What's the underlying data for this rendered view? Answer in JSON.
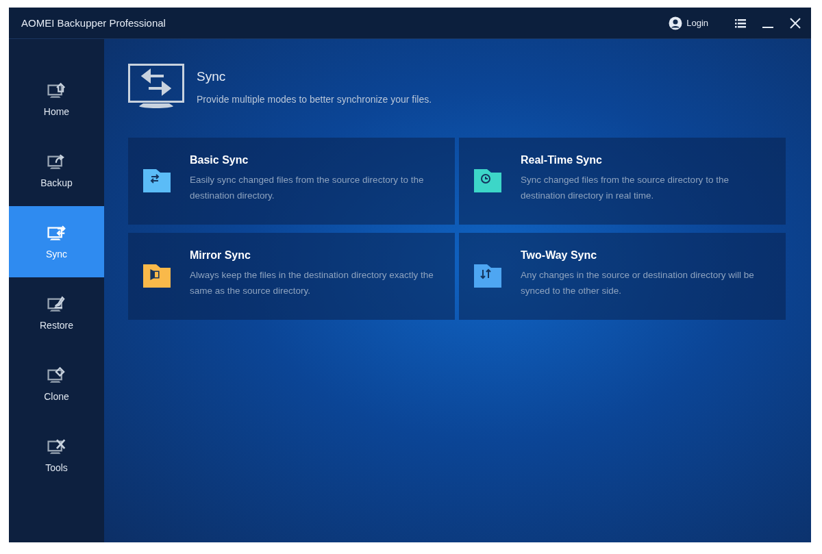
{
  "window": {
    "title": "AOMEI Backupper Professional",
    "login": "Login"
  },
  "sidebar": {
    "items": [
      {
        "label": "Home",
        "kind": "home",
        "selected": false
      },
      {
        "label": "Backup",
        "kind": "backup",
        "selected": false
      },
      {
        "label": "Sync",
        "kind": "sync",
        "selected": true
      },
      {
        "label": "Restore",
        "kind": "restore",
        "selected": false
      },
      {
        "label": "Clone",
        "kind": "clone",
        "selected": false
      },
      {
        "label": "Tools",
        "kind": "tools",
        "selected": false
      }
    ]
  },
  "header": {
    "title": "Sync",
    "subtitle": "Provide multiple modes to better synchronize your files."
  },
  "cards": [
    {
      "kind": "basic",
      "title": "Basic Sync",
      "description": "Easily sync changed files from the source directory to the destination directory.",
      "color": "#5bbcf7"
    },
    {
      "kind": "realtime",
      "title": "Real-Time Sync",
      "description": "Sync changed files from the source directory to the destination directory in real time.",
      "color": "#3dd6c8"
    },
    {
      "kind": "mirror",
      "title": "Mirror Sync",
      "description": "Always keep the files in the destination directory exactly the same as the source directory.",
      "color": "#f9b94a"
    },
    {
      "kind": "twoway",
      "title": "Two-Way Sync",
      "description": "Any changes in the source or destination directory will be synced to the other side.",
      "color": "#4ea6f2"
    }
  ]
}
